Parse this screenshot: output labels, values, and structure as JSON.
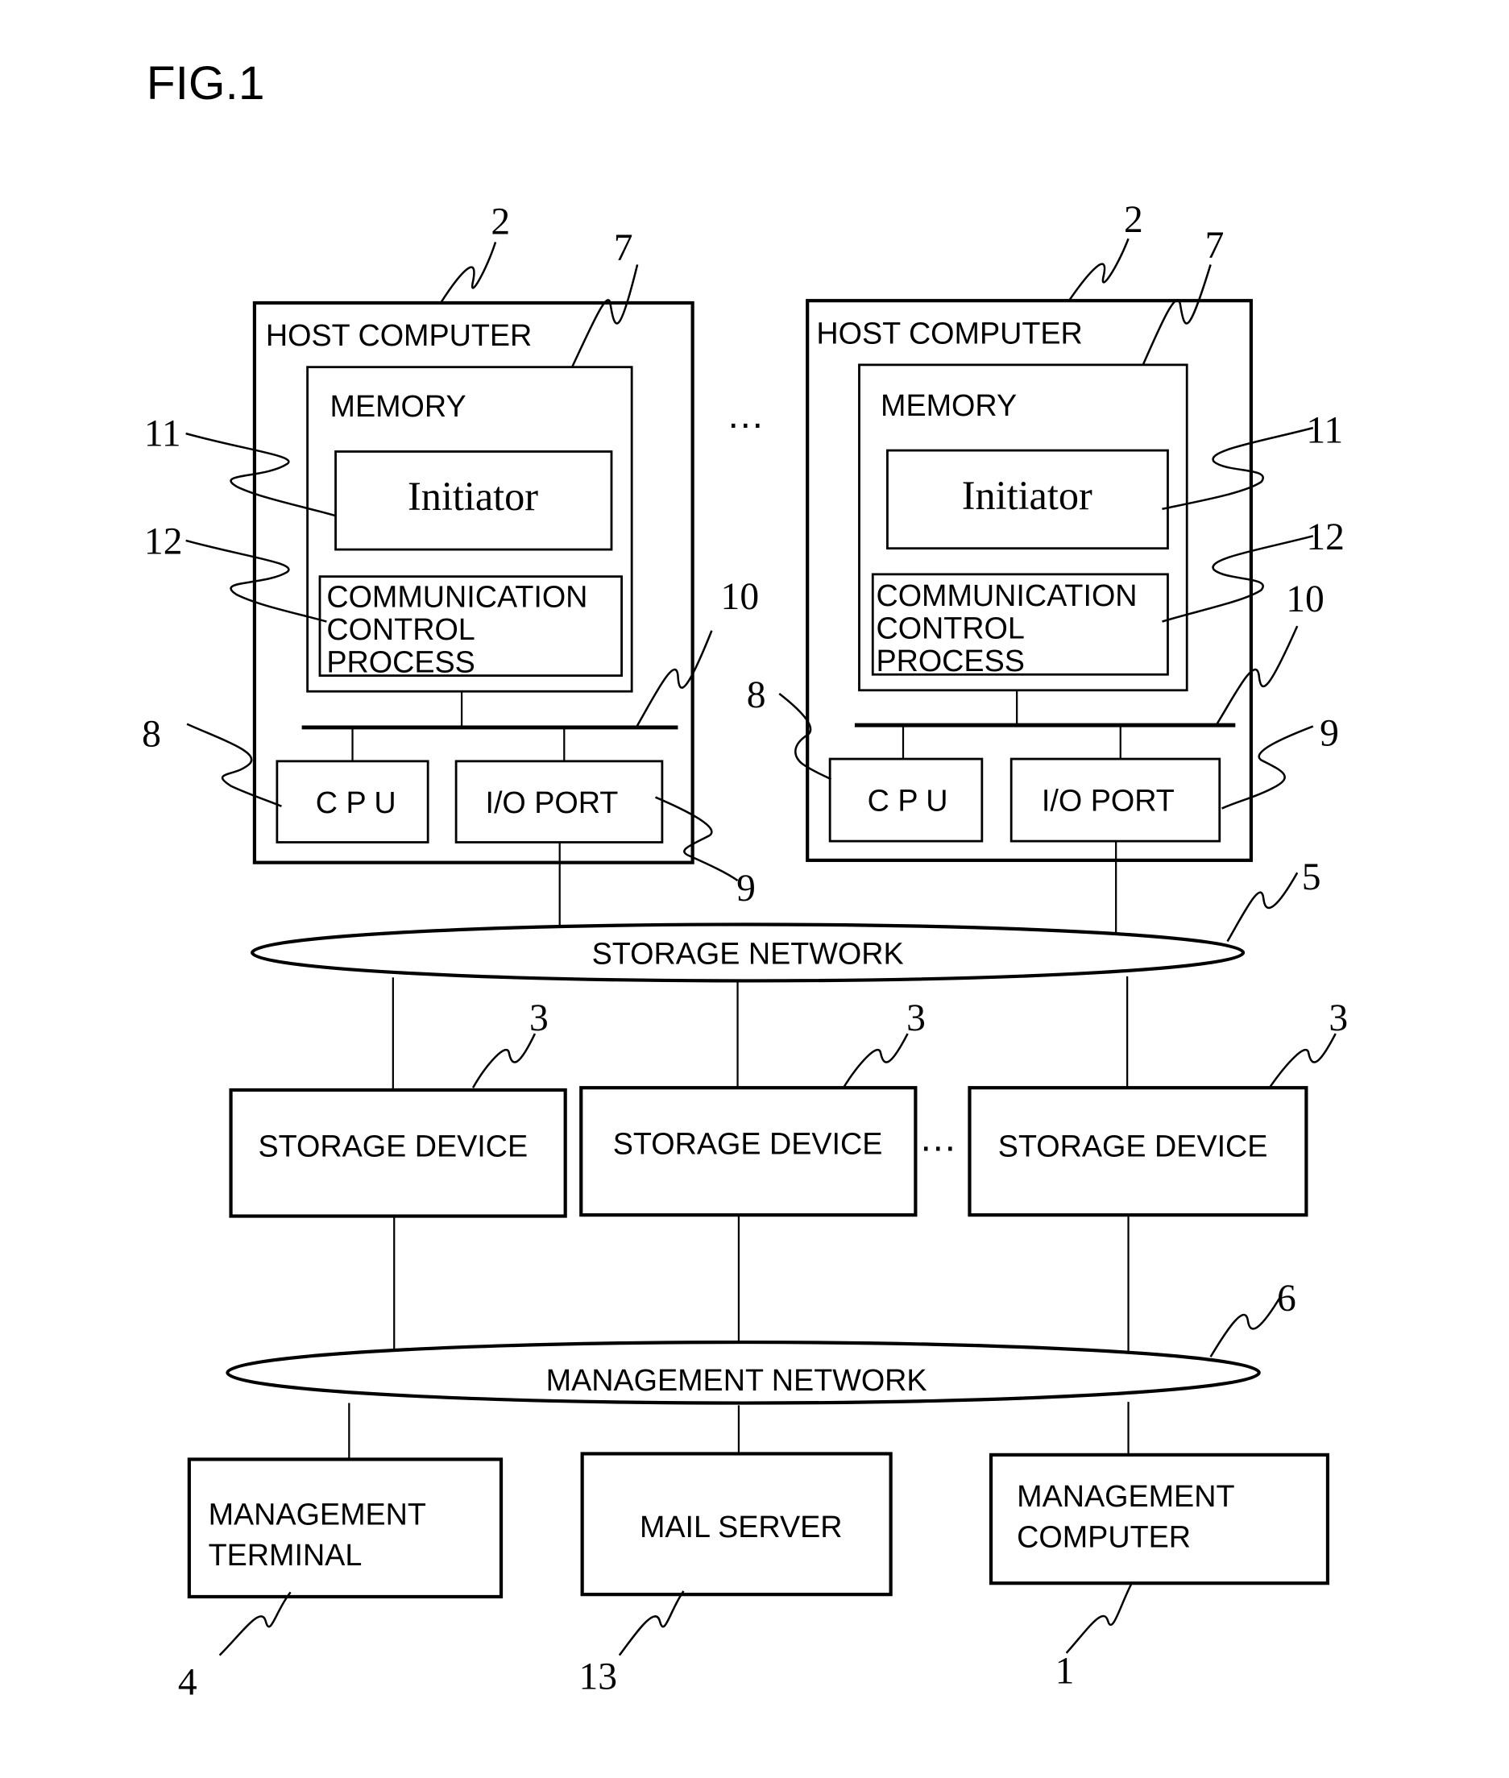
{
  "figure": {
    "title": "FIG.1"
  },
  "host_computers": [
    {
      "label": "HOST COMPUTER",
      "ref": "2",
      "memory": {
        "label": "MEMORY",
        "ref": "7"
      },
      "initiator": {
        "label": "Initiator",
        "ref": "11"
      },
      "comm_process": {
        "lines": [
          "COMMUNICATION",
          "CONTROL",
          "PROCESS"
        ],
        "ref": "12"
      },
      "bus_ref": "10",
      "cpu": {
        "label": "C P U",
        "ref": "8"
      },
      "io_port": {
        "label": "I/O PORT",
        "ref": "9"
      }
    },
    {
      "label": "HOST COMPUTER",
      "ref": "2",
      "memory": {
        "label": "MEMORY",
        "ref": "7"
      },
      "initiator": {
        "label": "Initiator",
        "ref": "11"
      },
      "comm_process": {
        "lines": [
          "COMMUNICATION",
          "CONTROL",
          "PROCESS"
        ],
        "ref": "12"
      },
      "bus_ref": "10",
      "cpu": {
        "label": "C P U",
        "ref": "8"
      },
      "io_port": {
        "label": "I/O PORT",
        "ref": "9"
      }
    }
  ],
  "host_ellipsis": "…",
  "storage_network": {
    "label": "STORAGE NETWORK",
    "ref": "5"
  },
  "storage_devices": [
    {
      "label": "STORAGE DEVICE",
      "ref": "3"
    },
    {
      "label": "STORAGE DEVICE",
      "ref": "3"
    },
    {
      "label": "STORAGE DEVICE",
      "ref": "3"
    }
  ],
  "storage_ellipsis": "…",
  "management_network": {
    "label": "MANAGEMENT NETWORK",
    "ref": "6"
  },
  "bottom_nodes": [
    {
      "lines": [
        "MANAGEMENT",
        "TERMINAL"
      ],
      "ref": "4"
    },
    {
      "lines": [
        "MAIL SERVER"
      ],
      "ref": "13"
    },
    {
      "lines": [
        "MANAGEMENT",
        "COMPUTER"
      ],
      "ref": "1"
    }
  ]
}
